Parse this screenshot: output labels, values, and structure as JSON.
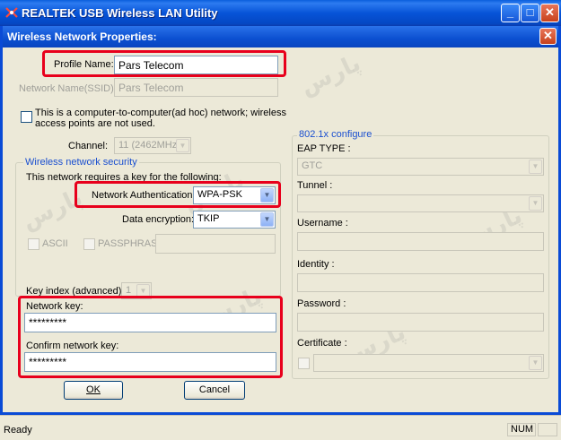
{
  "window": {
    "title": "REALTEK USB Wireless LAN Utility",
    "minimize_symbol": "_",
    "maximize_symbol": "□",
    "close_symbol": "✕"
  },
  "dialog": {
    "title": "Wireless Network Properties:",
    "close_symbol": "✕"
  },
  "profile": {
    "profile_name_label": "Profile Name:",
    "profile_name_value": "Pars Telecom",
    "ssid_label": "Network Name(SSID):",
    "ssid_value": "Pars Telecom",
    "adhoc_label_line1": "This is a computer-to-computer(ad hoc) network; wireless",
    "adhoc_label_line2": "access points are not used.",
    "channel_label": "Channel:",
    "channel_value": "11 (2462MHz)"
  },
  "security": {
    "group_title": "Wireless network security",
    "intro": "This network requires a key for the following:",
    "auth_label": "Network Authentication:",
    "auth_value": "WPA-PSK",
    "encryption_label": "Data encryption:",
    "encryption_value": "TKIP",
    "ascii_label": "ASCII",
    "passphrase_label": "PASSPHRASE",
    "key_index_label": "Key index (advanced):",
    "key_index_value": "1",
    "network_key_label": "Network key:",
    "network_key_value": "*********",
    "confirm_key_label": "Confirm network key:",
    "confirm_key_value": "*********"
  },
  "eap": {
    "group_title": "802.1x configure",
    "eap_type_label": "EAP TYPE :",
    "eap_type_value": "GTC",
    "tunnel_label": "Tunnel :",
    "username_label": "Username :",
    "identity_label": "Identity :",
    "password_label": "Password :",
    "certificate_label": "Certificate :"
  },
  "buttons": {
    "ok_label": "OK",
    "cancel_label": "Cancel"
  },
  "status": {
    "left": "Ready",
    "num": "NUM"
  },
  "colors": {
    "highlight": "#e8001c",
    "titlebar": "#0a5fdc",
    "group_title": "#1a4fd0"
  }
}
